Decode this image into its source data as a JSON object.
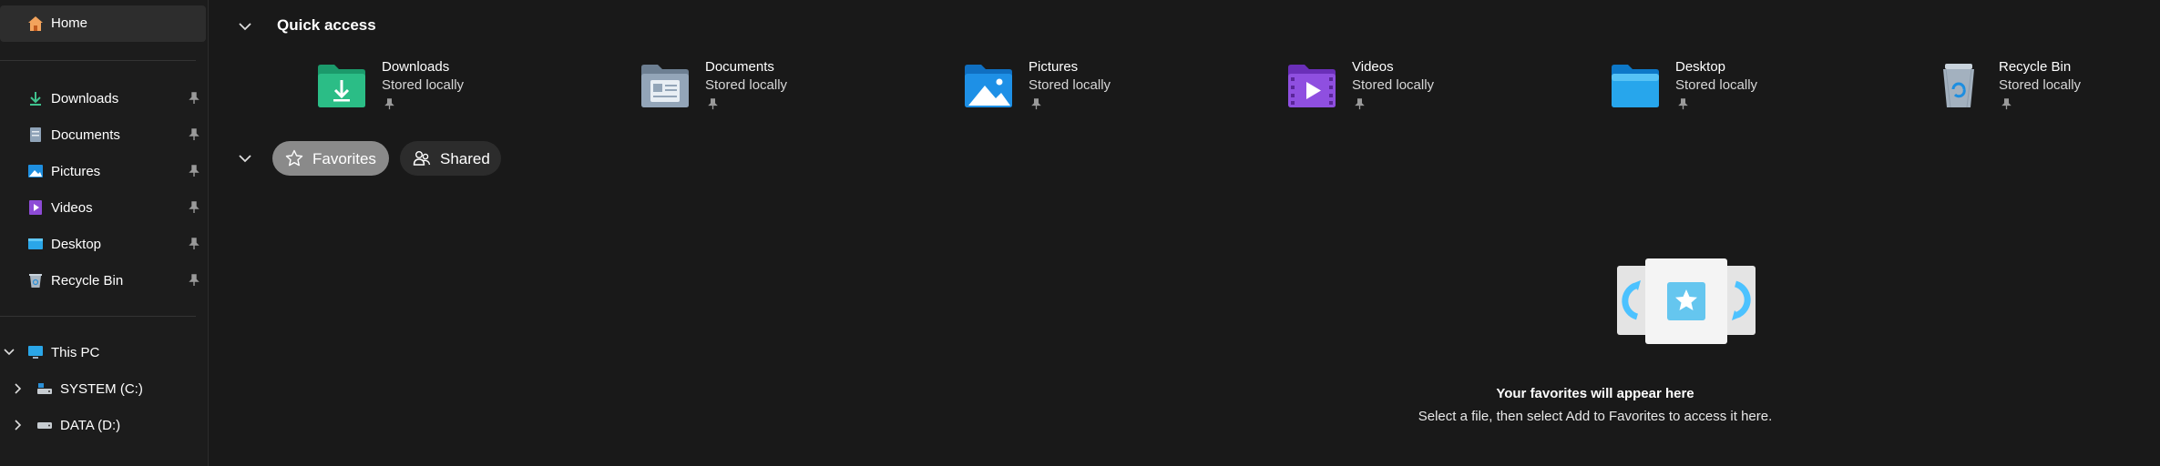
{
  "sidebar": {
    "home": {
      "label": "Home"
    },
    "pinned": [
      {
        "label": "Downloads",
        "icon": "downloads-icon"
      },
      {
        "label": "Documents",
        "icon": "documents-icon"
      },
      {
        "label": "Pictures",
        "icon": "pictures-icon"
      },
      {
        "label": "Videos",
        "icon": "videos-icon"
      },
      {
        "label": "Desktop",
        "icon": "desktop-icon"
      },
      {
        "label": "Recycle Bin",
        "icon": "recycle-bin-icon"
      }
    ],
    "this_pc": {
      "label": "This PC"
    },
    "drives": [
      {
        "label": "SYSTEM (C:)"
      },
      {
        "label": "DATA (D:)"
      }
    ]
  },
  "quick_access": {
    "title": "Quick access",
    "items": [
      {
        "name": "Downloads",
        "status": "Stored locally"
      },
      {
        "name": "Documents",
        "status": "Stored locally"
      },
      {
        "name": "Pictures",
        "status": "Stored locally"
      },
      {
        "name": "Videos",
        "status": "Stored locally"
      },
      {
        "name": "Desktop",
        "status": "Stored locally"
      },
      {
        "name": "Recycle Bin",
        "status": "Stored locally"
      }
    ]
  },
  "tabs": {
    "favorites": "Favorites",
    "shared": "Shared"
  },
  "empty_state": {
    "title": "Your favorites will appear here",
    "subtitle": "Select a file, then select Add to Favorites to access it here."
  },
  "colors": {
    "background": "#191919",
    "selected_pill": "#8a8a8a",
    "accent_blue": "#4cc2ff"
  }
}
